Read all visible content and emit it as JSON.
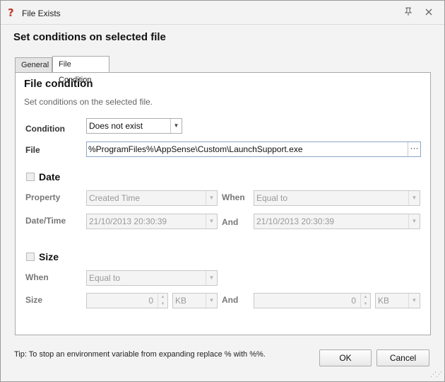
{
  "window": {
    "title": "File Exists",
    "pin_icon": "pin-icon",
    "close_icon": "close-icon"
  },
  "header": {
    "title": "Set conditions on selected file"
  },
  "tabs": [
    {
      "label": "General"
    },
    {
      "label": "File Condition"
    }
  ],
  "file_condition": {
    "title": "File condition",
    "subtitle": "Set conditions on the selected file.",
    "condition_label": "Condition",
    "condition_value": "Does not exist",
    "file_label": "File",
    "file_value": "%ProgramFiles%\\AppSense\\Custom\\LaunchSupport.exe",
    "browse_label": "···"
  },
  "date": {
    "title": "Date",
    "property_label": "Property",
    "property_value": "Created Time",
    "when_label": "When",
    "when_value": "Equal to",
    "datetime_label": "Date/Time",
    "datetime_value": "21/10/2013 20:30:39",
    "and_label": "And",
    "and_value": "21/10/2013 20:30:39"
  },
  "size": {
    "title": "Size",
    "when_label": "When",
    "when_value": "Equal to",
    "size_label": "Size",
    "size_value": "0",
    "size_unit": "KB",
    "and_label": "And",
    "and_value": "0",
    "and_unit": "KB"
  },
  "footer": {
    "tip": "Tip: To stop an environment variable from expanding replace % with %%.",
    "ok_label": "OK",
    "cancel_label": "Cancel"
  }
}
